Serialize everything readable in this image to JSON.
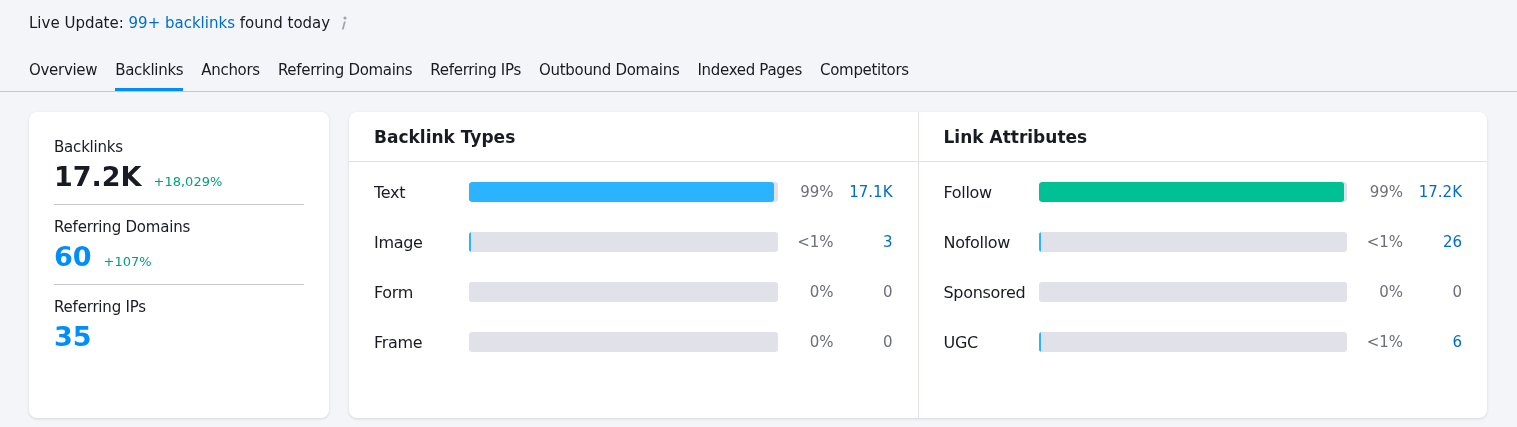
{
  "live_update": {
    "prefix": "Live Update:",
    "link": "99+ backlinks",
    "suffix": "found today"
  },
  "tabs": [
    {
      "label": "Overview",
      "selected": false
    },
    {
      "label": "Backlinks",
      "selected": true
    },
    {
      "label": "Anchors",
      "selected": false
    },
    {
      "label": "Referring Domains",
      "selected": false
    },
    {
      "label": "Referring IPs",
      "selected": false
    },
    {
      "label": "Outbound Domains",
      "selected": false
    },
    {
      "label": "Indexed Pages",
      "selected": false
    },
    {
      "label": "Competitors",
      "selected": false
    }
  ],
  "summary": [
    {
      "label": "Backlinks",
      "value": "17.2K",
      "is_link": false,
      "delta": "+18,029%"
    },
    {
      "label": "Referring Domains",
      "value": "60",
      "is_link": true,
      "delta": "+107%"
    },
    {
      "label": "Referring IPs",
      "value": "35",
      "is_link": true
    }
  ],
  "panels": [
    {
      "title": "Backlink Types",
      "rows": [
        {
          "label": "Text",
          "level": 0.99,
          "color": "#2bb3ff",
          "percent": "99%",
          "count": "17.1K",
          "is_link": true
        },
        {
          "label": "Image",
          "level": 0.005,
          "color": "#2bb3ff",
          "percent": "<1%",
          "count": "3",
          "is_link": true
        },
        {
          "label": "Form",
          "level": 0,
          "percent": "0%",
          "count": "0",
          "is_link": false
        },
        {
          "label": "Frame",
          "level": 0,
          "percent": "0%",
          "count": "0",
          "is_link": false
        }
      ]
    },
    {
      "title": "Link Attributes",
      "rows": [
        {
          "label": "Follow",
          "level": 0.99,
          "color": "#00c096",
          "percent": "99%",
          "count": "17.2K",
          "is_link": true
        },
        {
          "label": "Nofollow",
          "level": 0.005,
          "color": "#2bb3ff",
          "percent": "<1%",
          "count": "26",
          "is_link": true
        },
        {
          "label": "Sponsored",
          "level": 0,
          "percent": "0%",
          "count": "0",
          "is_link": false
        },
        {
          "label": "UGC",
          "level": 0.005,
          "color": "#2bb3ff",
          "percent": "<1%",
          "count": "6",
          "is_link": true
        }
      ]
    }
  ]
}
